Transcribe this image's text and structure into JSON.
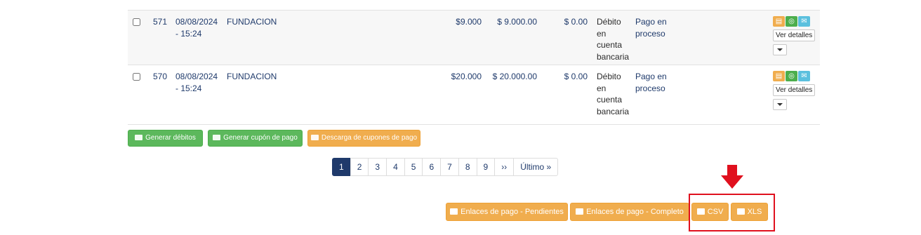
{
  "rows": [
    {
      "id": "571",
      "date": "08/08/2024",
      "time": "- 15:24",
      "name": "FUNDACION",
      "amount": "$9.000",
      "total": "$ 9.000.00",
      "commission": "$ 0.00",
      "method": [
        "Débito",
        "en",
        "cuenta",
        "bancaria"
      ],
      "status": [
        "Pago en",
        "proceso"
      ],
      "details_label": "Ver detalles"
    },
    {
      "id": "570",
      "date": "08/08/2024",
      "time": "- 15:24",
      "name": "FUNDACION",
      "amount": "$20.000",
      "total": "$ 20.000.00",
      "commission": "$ 0.00",
      "method": [
        "Débito",
        "en",
        "cuenta",
        "bancaria"
      ],
      "status": [
        "Pago en",
        "proceso"
      ],
      "details_label": "Ver detalles"
    }
  ],
  "actions": {
    "generate_debits": "Generar débitos",
    "generate_coupon": "Generar cupón de pago",
    "download_coupons": "Descarga de cupones de pago"
  },
  "pagination": {
    "pages": [
      "1",
      "2",
      "3",
      "4",
      "5",
      "6",
      "7",
      "8",
      "9"
    ],
    "next": "››",
    "last": "Último »",
    "active": "1"
  },
  "exports": {
    "pending_links": "Enlaces de pago - Pendientes",
    "complete_links": "Enlaces de pago - Completo",
    "csv": "CSV",
    "xls": "XLS"
  },
  "colors": {
    "primary": "#1f3a6b",
    "success": "#5cb85c",
    "warning": "#f0ad4e",
    "info": "#5bc0de",
    "highlight": "#e0101e"
  },
  "icons": [
    "copy-icon",
    "whatsapp-icon",
    "email-icon",
    "credit-card-icon",
    "list-icon",
    "download-icon",
    "chevron-down-icon",
    "arrow-down-icon"
  ]
}
